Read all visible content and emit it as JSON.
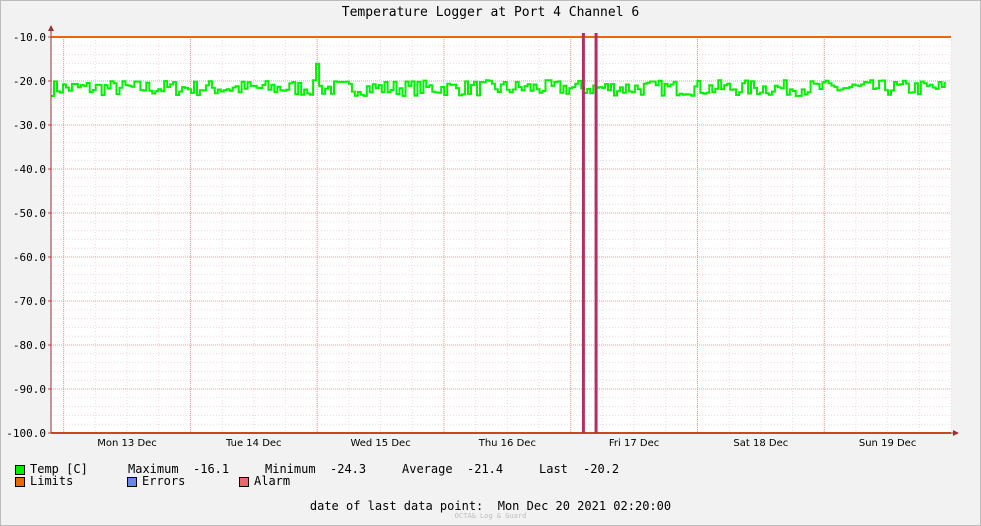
{
  "chart_data": {
    "type": "line",
    "title": "Temperature Logger at Port 4 Channel 6",
    "y_ticks": [
      "-10.0",
      "-20.0",
      "-30.0",
      "-40.0",
      "-50.0",
      "-60.0",
      "-70.0",
      "-80.0",
      "-90.0",
      "-100.0"
    ],
    "ylim": [
      -100,
      -10
    ],
    "x_ticks": [
      "Mon 13 Dec",
      "Tue 14 Dec",
      "Wed 15 Dec",
      "Thu 16 Dec",
      "Fri 17 Dec",
      "Sat 18 Dec",
      "Sun 19 Dec"
    ],
    "xlim_days": [
      12.9,
      20.0
    ],
    "grid": true,
    "series": [
      {
        "name": "Temp [C]",
        "color": "#00ee00",
        "mean": -21.4,
        "typical_range": [
          -23.4,
          -19.8
        ],
        "spike": {
          "day": 15.0,
          "value": -16.1
        },
        "min": -24.3,
        "last": -20.2
      }
    ],
    "limits": {
      "name": "Limits",
      "values": [
        -10.0,
        -100.0
      ],
      "color": "#ee6600"
    },
    "alarm_markers": {
      "days": [
        17.1,
        17.2
      ],
      "color": "#b03060"
    },
    "legend": {
      "temp": "Temp [C]",
      "limits": "Limits",
      "errors": "Errors",
      "alarm": "Alarm"
    },
    "stats": {
      "maximum_label": "Maximum",
      "maximum": "-16.1",
      "minimum_label": "Minimum",
      "minimum": "-24.3",
      "average_label": "Average",
      "average": "-21.4",
      "last_label": "Last",
      "last": "-20.2"
    },
    "colors": {
      "temp": "#00ee00",
      "limits": "#ee6600",
      "errors": "#6688ee",
      "alarm": "#ee6666"
    }
  },
  "footer": {
    "last_data_point": "date of last data point:  Mon Dec 20 2021 02:20:00",
    "watermark": "OCTA& Log & Guard"
  }
}
